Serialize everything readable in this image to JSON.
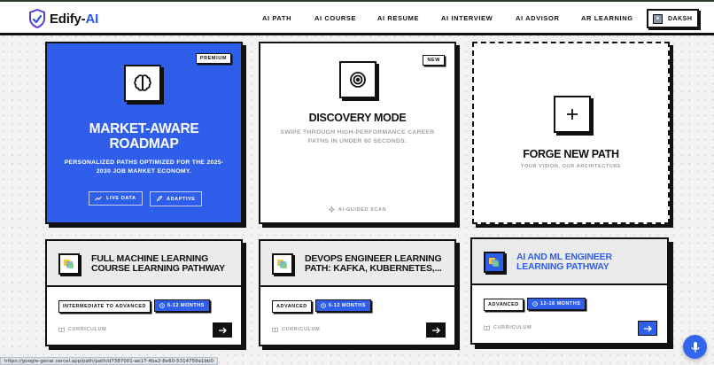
{
  "header": {
    "logo": {
      "brand": "Edify-",
      "brand_accent": "AI"
    },
    "nav": [
      {
        "label": "AI PATH"
      },
      {
        "label": "AI COURSE"
      },
      {
        "label": "AI RESUME"
      },
      {
        "label": "AI INTERVIEW"
      },
      {
        "label": "AI ADVISOR"
      },
      {
        "label": "AR LEARNING"
      }
    ],
    "user": {
      "name": "DAKSH"
    }
  },
  "hero_cards": [
    {
      "badge": "PREMIUM",
      "icon": "brain-icon",
      "title_line1": "MARKET-AWARE",
      "title_line2": "ROADMAP",
      "description": "PERSONALIZED PATHS OPTIMIZED FOR THE 2025-2030 JOB MARKET ECONOMY.",
      "chips": [
        "LIVE DATA",
        "ADAPTIVE"
      ]
    },
    {
      "badge": "NEW",
      "icon": "target-icon",
      "title": "DISCOVERY MODE",
      "description": "SWIPE THROUGH HIGH-PERFORMANCE CAREER PATHS IN UNDER 60 SECONDS.",
      "footer": "AI-GUIDED SCAN"
    },
    {
      "icon": "plus-icon",
      "title": "FORGE NEW PATH",
      "subtitle": "YOUR VISION, OUR ARCHITECTURE"
    }
  ],
  "course_cards": [
    {
      "title": "FULL MACHINE LEARNING COURSE LEARNING PATHWAY",
      "level": "INTERMEDIATE TO ADVANCED",
      "duration": "6-12 MONTHS",
      "curriculum_label": "CURRICULUM"
    },
    {
      "title": "DEVOPS ENGINEER LEARNING PATH: KAFKA, KUBERNETES,...",
      "level": "ADVANCED",
      "duration": "6-12 MONTHS",
      "curriculum_label": "CURRICULUM"
    },
    {
      "title": "AI AND ML ENGINEER LEARNING PATHWAY",
      "level": "ADVANCED",
      "duration": "12-18 MONTHS",
      "curriculum_label": "CURRICULUM"
    }
  ],
  "status_bar": {
    "url": "https://google-genai.vercel.app/path/path/d7387001-ae17-4ba2-8e60-5314759a1bb0"
  },
  "colors": {
    "accent": "#2f5fea",
    "ink": "#111111",
    "muted": "#9b9b9b",
    "page_bg": "#f2f2f2"
  }
}
